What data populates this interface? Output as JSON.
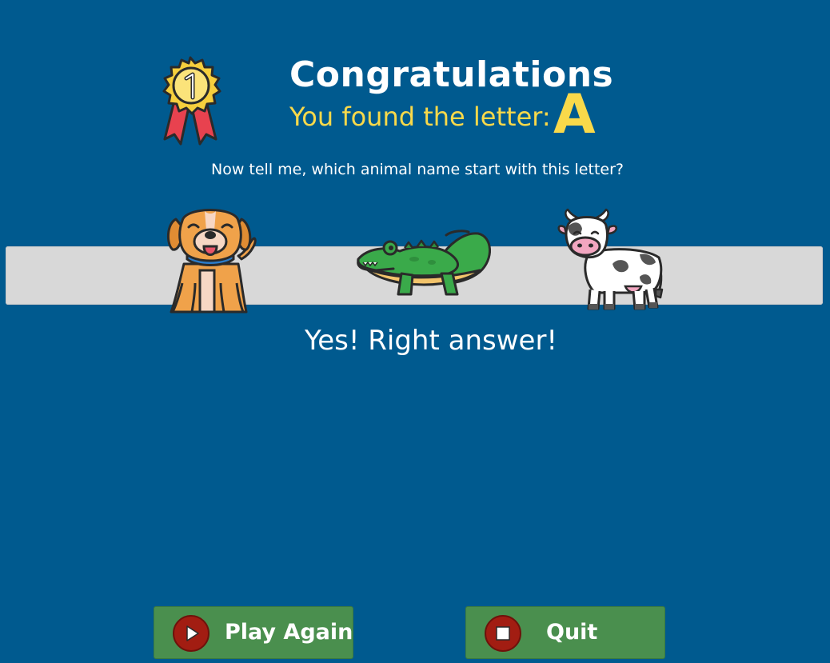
{
  "header": {
    "title": "Congratulations",
    "subtitle": "You found the letter:",
    "letter": "A"
  },
  "question": "Now tell me, which animal name start with this letter?",
  "animals": [
    {
      "name": "dog-icon"
    },
    {
      "name": "crocodile-icon"
    },
    {
      "name": "cow-icon"
    }
  ],
  "result": "Yes! Right answer!",
  "buttons": {
    "play_again": "Play Again",
    "quit": "Quit"
  },
  "colors": {
    "background": "#005a8f",
    "accent": "#f9d94a",
    "button": "#4a8f4e",
    "button_icon": "#a21d12",
    "bar": "#d8d8d8"
  }
}
